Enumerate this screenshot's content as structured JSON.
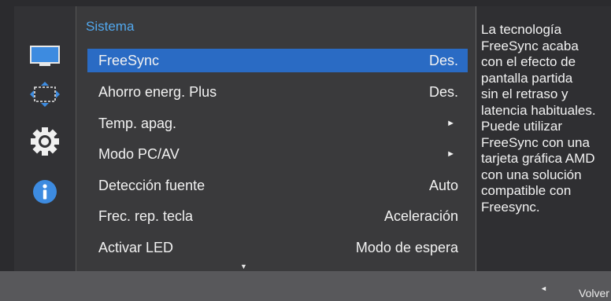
{
  "menu": {
    "title": "Sistema",
    "items": [
      {
        "label": "FreeSync",
        "value": "Des."
      },
      {
        "label": "Ahorro energ. Plus",
        "value": "Des."
      },
      {
        "label": "Temp. apag.",
        "value": "►"
      },
      {
        "label": "Modo PC/AV",
        "value": "►"
      },
      {
        "label": "Detección fuente",
        "value": "Auto"
      },
      {
        "label": "Frec. rep. tecla",
        "value": "Aceleración"
      },
      {
        "label": "Activar LED",
        "value": "Modo de espera"
      }
    ],
    "scroll_indicator": "▼"
  },
  "sidebar": {
    "icons": [
      "monitor-icon",
      "position-size-icon",
      "system-gear-icon",
      "info-icon"
    ],
    "selected": "system-gear-icon"
  },
  "description": {
    "text": "La tecnología\nFreeSync acaba\ncon el efecto de\npantalla partida\nsin el retraso y\nlatencia habituales.\nPuede utilizar\nFreeSync con una\ntarjeta gráfica AMD\ncon una solución\ncompatible con\nFreesync."
  },
  "footer": {
    "back_icon": "◄",
    "back_label": "Volver"
  },
  "colors": {
    "accent": "#2a6bc4",
    "title": "#52a8ee"
  }
}
